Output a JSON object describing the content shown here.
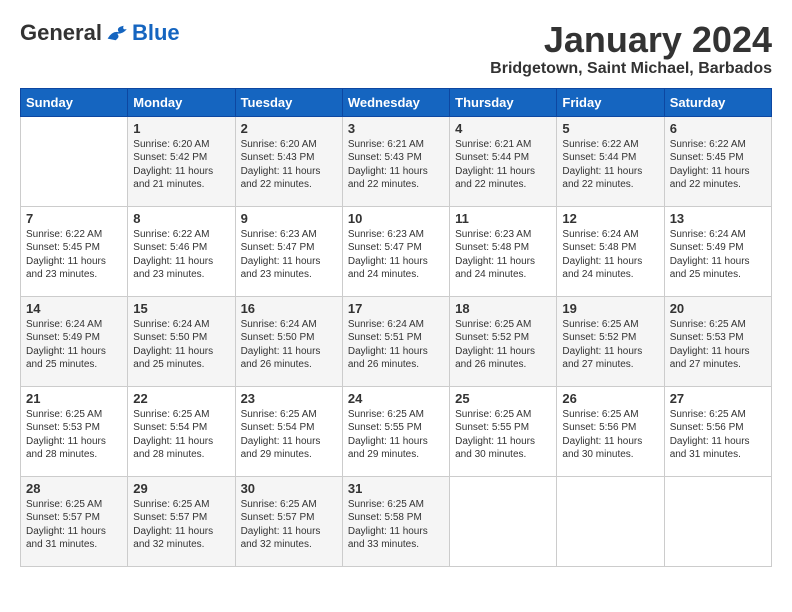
{
  "header": {
    "logo_general": "General",
    "logo_blue": "Blue",
    "month_title": "January 2024",
    "location": "Bridgetown, Saint Michael, Barbados"
  },
  "days_of_week": [
    "Sunday",
    "Monday",
    "Tuesday",
    "Wednesday",
    "Thursday",
    "Friday",
    "Saturday"
  ],
  "weeks": [
    [
      {
        "day": "",
        "info": ""
      },
      {
        "day": "1",
        "info": "Sunrise: 6:20 AM\nSunset: 5:42 PM\nDaylight: 11 hours\nand 21 minutes."
      },
      {
        "day": "2",
        "info": "Sunrise: 6:20 AM\nSunset: 5:43 PM\nDaylight: 11 hours\nand 22 minutes."
      },
      {
        "day": "3",
        "info": "Sunrise: 6:21 AM\nSunset: 5:43 PM\nDaylight: 11 hours\nand 22 minutes."
      },
      {
        "day": "4",
        "info": "Sunrise: 6:21 AM\nSunset: 5:44 PM\nDaylight: 11 hours\nand 22 minutes."
      },
      {
        "day": "5",
        "info": "Sunrise: 6:22 AM\nSunset: 5:44 PM\nDaylight: 11 hours\nand 22 minutes."
      },
      {
        "day": "6",
        "info": "Sunrise: 6:22 AM\nSunset: 5:45 PM\nDaylight: 11 hours\nand 22 minutes."
      }
    ],
    [
      {
        "day": "7",
        "info": "Sunrise: 6:22 AM\nSunset: 5:45 PM\nDaylight: 11 hours\nand 23 minutes."
      },
      {
        "day": "8",
        "info": "Sunrise: 6:22 AM\nSunset: 5:46 PM\nDaylight: 11 hours\nand 23 minutes."
      },
      {
        "day": "9",
        "info": "Sunrise: 6:23 AM\nSunset: 5:47 PM\nDaylight: 11 hours\nand 23 minutes."
      },
      {
        "day": "10",
        "info": "Sunrise: 6:23 AM\nSunset: 5:47 PM\nDaylight: 11 hours\nand 24 minutes."
      },
      {
        "day": "11",
        "info": "Sunrise: 6:23 AM\nSunset: 5:48 PM\nDaylight: 11 hours\nand 24 minutes."
      },
      {
        "day": "12",
        "info": "Sunrise: 6:24 AM\nSunset: 5:48 PM\nDaylight: 11 hours\nand 24 minutes."
      },
      {
        "day": "13",
        "info": "Sunrise: 6:24 AM\nSunset: 5:49 PM\nDaylight: 11 hours\nand 25 minutes."
      }
    ],
    [
      {
        "day": "14",
        "info": "Sunrise: 6:24 AM\nSunset: 5:49 PM\nDaylight: 11 hours\nand 25 minutes."
      },
      {
        "day": "15",
        "info": "Sunrise: 6:24 AM\nSunset: 5:50 PM\nDaylight: 11 hours\nand 25 minutes."
      },
      {
        "day": "16",
        "info": "Sunrise: 6:24 AM\nSunset: 5:50 PM\nDaylight: 11 hours\nand 26 minutes."
      },
      {
        "day": "17",
        "info": "Sunrise: 6:24 AM\nSunset: 5:51 PM\nDaylight: 11 hours\nand 26 minutes."
      },
      {
        "day": "18",
        "info": "Sunrise: 6:25 AM\nSunset: 5:52 PM\nDaylight: 11 hours\nand 26 minutes."
      },
      {
        "day": "19",
        "info": "Sunrise: 6:25 AM\nSunset: 5:52 PM\nDaylight: 11 hours\nand 27 minutes."
      },
      {
        "day": "20",
        "info": "Sunrise: 6:25 AM\nSunset: 5:53 PM\nDaylight: 11 hours\nand 27 minutes."
      }
    ],
    [
      {
        "day": "21",
        "info": "Sunrise: 6:25 AM\nSunset: 5:53 PM\nDaylight: 11 hours\nand 28 minutes."
      },
      {
        "day": "22",
        "info": "Sunrise: 6:25 AM\nSunset: 5:54 PM\nDaylight: 11 hours\nand 28 minutes."
      },
      {
        "day": "23",
        "info": "Sunrise: 6:25 AM\nSunset: 5:54 PM\nDaylight: 11 hours\nand 29 minutes."
      },
      {
        "day": "24",
        "info": "Sunrise: 6:25 AM\nSunset: 5:55 PM\nDaylight: 11 hours\nand 29 minutes."
      },
      {
        "day": "25",
        "info": "Sunrise: 6:25 AM\nSunset: 5:55 PM\nDaylight: 11 hours\nand 30 minutes."
      },
      {
        "day": "26",
        "info": "Sunrise: 6:25 AM\nSunset: 5:56 PM\nDaylight: 11 hours\nand 30 minutes."
      },
      {
        "day": "27",
        "info": "Sunrise: 6:25 AM\nSunset: 5:56 PM\nDaylight: 11 hours\nand 31 minutes."
      }
    ],
    [
      {
        "day": "28",
        "info": "Sunrise: 6:25 AM\nSunset: 5:57 PM\nDaylight: 11 hours\nand 31 minutes."
      },
      {
        "day": "29",
        "info": "Sunrise: 6:25 AM\nSunset: 5:57 PM\nDaylight: 11 hours\nand 32 minutes."
      },
      {
        "day": "30",
        "info": "Sunrise: 6:25 AM\nSunset: 5:57 PM\nDaylight: 11 hours\nand 32 minutes."
      },
      {
        "day": "31",
        "info": "Sunrise: 6:25 AM\nSunset: 5:58 PM\nDaylight: 11 hours\nand 33 minutes."
      },
      {
        "day": "",
        "info": ""
      },
      {
        "day": "",
        "info": ""
      },
      {
        "day": "",
        "info": ""
      }
    ]
  ]
}
